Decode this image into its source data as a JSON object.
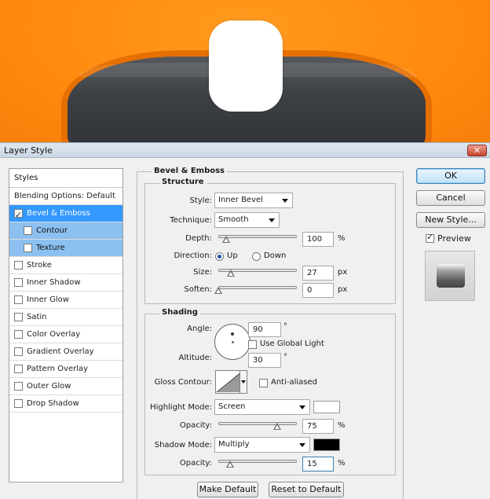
{
  "dialog": {
    "title": "Layer Style",
    "close": "✕"
  },
  "styles_list": {
    "header": "Styles",
    "blending": "Blending Options: Default",
    "items": [
      {
        "label": "Bevel & Emboss",
        "checked": true
      },
      {
        "label": "Contour",
        "checked": false
      },
      {
        "label": "Texture",
        "checked": false
      },
      {
        "label": "Stroke",
        "checked": false
      },
      {
        "label": "Inner Shadow",
        "checked": false
      },
      {
        "label": "Inner Glow",
        "checked": false
      },
      {
        "label": "Satin",
        "checked": false
      },
      {
        "label": "Color Overlay",
        "checked": false
      },
      {
        "label": "Gradient Overlay",
        "checked": false
      },
      {
        "label": "Pattern Overlay",
        "checked": false
      },
      {
        "label": "Outer Glow",
        "checked": false
      },
      {
        "label": "Drop Shadow",
        "checked": false
      }
    ]
  },
  "bevel": {
    "section_title": "Bevel & Emboss",
    "structure": {
      "title": "Structure",
      "style_label": "Style:",
      "style_value": "Inner Bevel",
      "technique_label": "Technique:",
      "technique_value": "Smooth",
      "depth_label": "Depth:",
      "depth_value": "100",
      "depth_unit": "%",
      "depth_slider": 0.1,
      "direction_label": "Direction:",
      "direction_up": "Up",
      "direction_down": "Down",
      "direction_selected": "Up",
      "size_label": "Size:",
      "size_value": "27",
      "size_unit": "px",
      "size_slider": 0.16,
      "soften_label": "Soften:",
      "soften_value": "0",
      "soften_unit": "px",
      "soften_slider": 0.0
    },
    "shading": {
      "title": "Shading",
      "angle_label": "Angle:",
      "angle_value": "90",
      "angle_unit": "°",
      "global_light_label": "Use Global Light",
      "global_light_checked": false,
      "altitude_label": "Altitude:",
      "altitude_value": "30",
      "altitude_unit": "°",
      "gloss_label": "Gloss Contour:",
      "anti_aliased_label": "Anti-aliased",
      "anti_aliased_checked": false,
      "highlight_mode_label": "Highlight Mode:",
      "highlight_mode_value": "Screen",
      "highlight_color": "#ffffff",
      "highlight_opacity_label": "Opacity:",
      "highlight_opacity_value": "75",
      "highlight_opacity_unit": "%",
      "highlight_opacity_slider": 0.75,
      "shadow_mode_label": "Shadow Mode:",
      "shadow_mode_value": "Multiply",
      "shadow_color": "#000000",
      "shadow_opacity_label": "Opacity:",
      "shadow_opacity_value": "15",
      "shadow_opacity_unit": "%",
      "shadow_opacity_slider": 0.15
    },
    "make_default": "Make Default",
    "reset_default": "Reset to Default"
  },
  "actions": {
    "ok": "OK",
    "cancel": "Cancel",
    "new_style": "New Style...",
    "preview_label": "Preview",
    "preview_checked": true
  }
}
